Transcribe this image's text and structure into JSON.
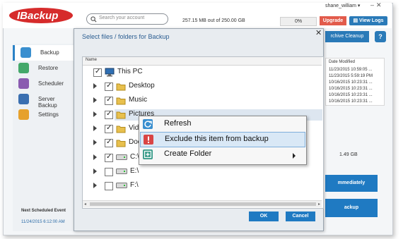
{
  "app": {
    "logo_text": "IBackup",
    "search_placeholder": "Search your account",
    "user": "shane_william",
    "usage": "257.15 MB out of 250.00 GB",
    "usage_pct": "0%",
    "upgrade_label": "Upgrade",
    "view_logs_label": "View Logs",
    "archive_cleanup_label": "rchive Cleanup",
    "help_label": "?",
    "size_label": "1.49 GB",
    "immediately_label": "mmediately",
    "backup_btn_label": "ackup",
    "date_modified_header": "Date Modified",
    "dates": [
      "11/23/2015 10:59:05 ...",
      "11/23/2015 5:59:19 PM",
      "10/16/2015 10:23:31 ...",
      "10/16/2015 10:23:31 ...",
      "10/16/2015 10:23:31 ...",
      "10/16/2015 10:23:31 ..."
    ],
    "next_event_title": "Next Scheduled Event",
    "next_event_date": "11/24/2015 6:12:00 AM"
  },
  "sidebar": {
    "items": [
      {
        "label": "Backup",
        "icon": "cloud-upload-icon",
        "color": "#3a8fcf"
      },
      {
        "label": "Restore",
        "icon": "cloud-download-icon",
        "color": "#44a86a"
      },
      {
        "label": "Scheduler",
        "icon": "clock-icon",
        "color": "#8a5bb0"
      },
      {
        "label": "Server Backup",
        "icon": "server-icon",
        "color": "#3a6fb0"
      },
      {
        "label": "Settings",
        "icon": "gear-icon",
        "color": "#e6a12c"
      }
    ]
  },
  "dialog": {
    "title": "Select files / folders for Backup",
    "column_name": "Name",
    "ok_label": "OK",
    "cancel_label": "Cancel",
    "tree": [
      {
        "label": "This PC",
        "checked": true,
        "expandable": false,
        "icon": "computer-icon",
        "level": 0
      },
      {
        "label": "Desktop",
        "checked": true,
        "expandable": true,
        "icon": "folder-icon",
        "level": 1
      },
      {
        "label": "Music",
        "checked": true,
        "expandable": true,
        "icon": "folder-icon",
        "level": 1
      },
      {
        "label": "Pictures",
        "checked": true,
        "expandable": true,
        "icon": "folder-icon",
        "level": 1
      },
      {
        "label": "Vid",
        "checked": true,
        "expandable": true,
        "icon": "folder-icon",
        "level": 1
      },
      {
        "label": "Doc",
        "checked": true,
        "expandable": true,
        "icon": "folder-icon",
        "level": 1
      },
      {
        "label": "C:\\",
        "checked": true,
        "expandable": true,
        "icon": "drive-icon",
        "level": 1
      },
      {
        "label": "E:\\",
        "checked": false,
        "expandable": true,
        "icon": "drive-icon",
        "level": 1
      },
      {
        "label": "F:\\",
        "checked": false,
        "expandable": true,
        "icon": "drive-icon",
        "level": 1
      }
    ]
  },
  "context_menu": {
    "items": [
      {
        "label": "Refresh",
        "icon": "refresh-icon"
      },
      {
        "label": "Exclude this item from backup",
        "icon": "exclude-icon"
      },
      {
        "label": "Create Folder",
        "icon": "create-folder-icon",
        "submenu": true
      }
    ]
  }
}
